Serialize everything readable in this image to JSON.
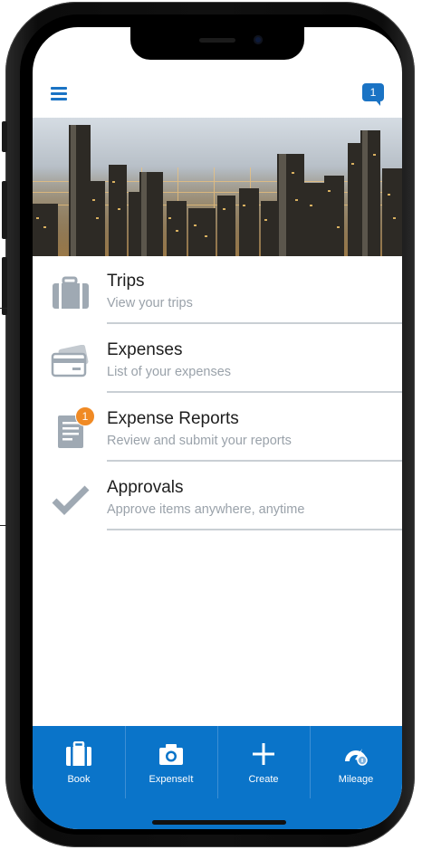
{
  "header": {
    "menu_icon": "hamburger-menu-icon",
    "chat_icon": "chat-bubble-icon",
    "chat_count": "1"
  },
  "hero": {
    "image": "city-skyline-photo"
  },
  "menu": {
    "items": [
      {
        "title": "Trips",
        "subtitle": "View your trips",
        "icon": "suitcase-icon"
      },
      {
        "title": "Expenses",
        "subtitle": "List of your expenses",
        "icon": "credit-card-icon"
      },
      {
        "title": "Expense Reports",
        "subtitle": "Review and submit your reports",
        "icon": "report-document-icon",
        "badge": "1"
      },
      {
        "title": "Approvals",
        "subtitle": "Approve items anywhere, anytime",
        "icon": "checkmark-icon"
      }
    ]
  },
  "tabbar": {
    "tabs": [
      {
        "label": "Book",
        "icon": "suitcase-icon"
      },
      {
        "label": "ExpenseIt",
        "icon": "camera-icon"
      },
      {
        "label": "Create",
        "icon": "plus-icon"
      },
      {
        "label": "Mileage",
        "icon": "speedometer-icon"
      }
    ]
  },
  "colors": {
    "accent": "#0a74c9",
    "badge": "#f08a24",
    "icon_gray": "#9fa9b3",
    "subtitle_gray": "#9aa2aa"
  }
}
